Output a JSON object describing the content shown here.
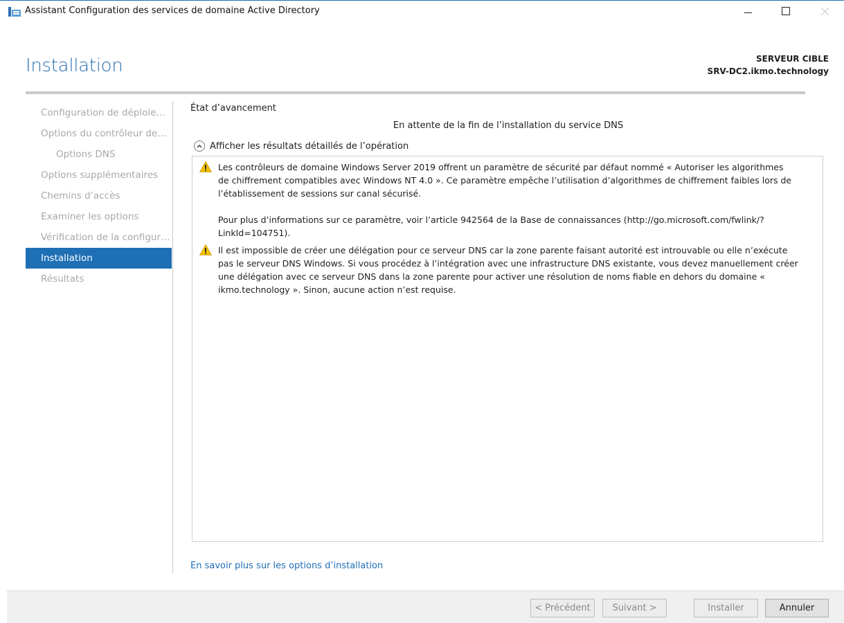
{
  "window": {
    "title": "Assistant Configuration des services de domaine Active Directory",
    "controls": {
      "minimize": "minimize-icon",
      "maximize": "maximize-icon",
      "close": "close-icon"
    }
  },
  "header": {
    "title": "Installation",
    "target_label": "SERVEUR CIBLE",
    "target_value": "SRV-DC2.ikmo.technology"
  },
  "nav": {
    "items": [
      {
        "label": "Configuration de déploie…",
        "state": "disabled"
      },
      {
        "label": "Options du contrôleur de…",
        "state": "disabled"
      },
      {
        "label": "Options DNS",
        "state": "disabled"
      },
      {
        "label": "Options supplémentaires",
        "state": "disabled"
      },
      {
        "label": "Chemins d’accès",
        "state": "disabled"
      },
      {
        "label": "Examiner les options",
        "state": "disabled"
      },
      {
        "label": "Vérification de la configur…",
        "state": "disabled"
      },
      {
        "label": "Installation",
        "state": "active"
      },
      {
        "label": "Résultats",
        "state": "disabled"
      }
    ]
  },
  "main": {
    "progress_label": "État d’avancement",
    "status": "En attente de la fin de l’installation du service DNS",
    "details_toggle": "Afficher les résultats détaillés de l’opération",
    "messages": [
      {
        "icon": "warning-icon",
        "text": "Les contrôleurs de domaine Windows Server 2019 offrent un paramètre de sécurité par défaut nommé « Autoriser les algorithmes\nde chiffrement compatibles avec Windows NT 4.0 ». Ce paramètre empêche l’utilisation d’algorithmes de chiffrement faibles lors de\nl’établissement de sessions sur canal sécurisé.\n\nPour plus d’informations sur ce paramètre, voir l’article 942564 de la Base de connaissances (http://go.microsoft.com/fwlink/?\nLinkId=104751)."
      },
      {
        "icon": "warning-icon",
        "text": "Il est impossible de créer une délégation pour ce serveur DNS car la zone parente faisant autorité est introuvable ou elle n’exécute\npas le serveur DNS Windows. Si vous procédez à l’intégration avec une infrastructure DNS existante, vous devez manuellement créer\nune délégation avec ce serveur DNS dans la zone parente pour activer une résolution de noms fiable en dehors du domaine «\nikmo.technology ». Sinon, aucune action n’est requise."
      }
    ],
    "learn_more": "En savoir plus sur les options d’installation"
  },
  "footer": {
    "previous": "< Précédent",
    "next": "Suivant >",
    "install": "Installer",
    "cancel": "Annuler"
  },
  "colors": {
    "accent": "#1f6fb5",
    "nav_disabled": "#a8a8a8",
    "warning": "#f2c200"
  }
}
